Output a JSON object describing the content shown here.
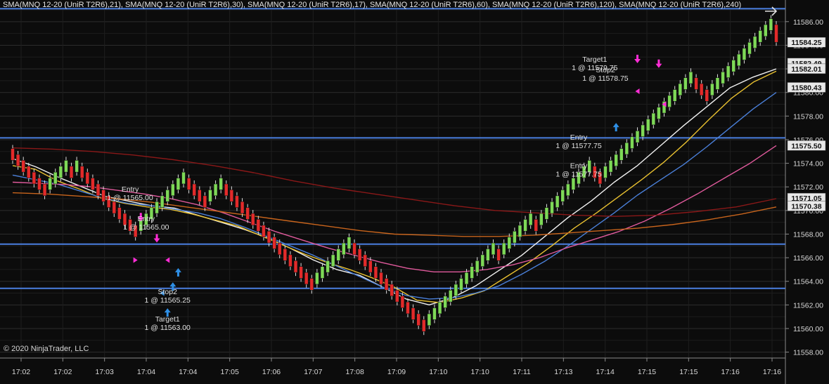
{
  "indicator_legend": "SMA(MNQ 12-20 (UniR T2R6),21), SMA(MNQ 12-20 (UniR T2R6),30), SMA(MNQ 12-20 (UniR T2R6),17), SMA(MNQ 12-20 (UniR T2R6),60), SMA(MNQ 12-20 (UniR T2R6),120), SMA(MNQ 12-20 (UniR T2R6),240)",
  "copyright": "© 2020 NinjaTrader, LLC",
  "nav_icon": "arrow-right-icon",
  "colors": {
    "background": "#0c0c0c",
    "grid": "#2a2a2a",
    "up_bar": "#7ed957",
    "down_bar": "#e32a2a",
    "horizontal_line": "#4a7fe0",
    "entry_marker": "#ff2dd6",
    "target_marker": "#2e8fe6",
    "label_box": "#e8e8e8"
  },
  "chart_data": {
    "type": "candlestick",
    "title": "",
    "xlabel": "",
    "ylabel": "",
    "ylim": [
      11557.5,
      11587.0
    ],
    "y_ticks": [
      "11586.00",
      "11584.00",
      "11582.00",
      "11580.00",
      "11578.00",
      "11576.00",
      "11574.00",
      "11572.00",
      "11570.00",
      "11568.00",
      "11566.00",
      "11564.00",
      "11562.00",
      "11560.00",
      "11558.00"
    ],
    "x_ticks": [
      "17:02",
      "17:02",
      "17:03",
      "17:04",
      "17:04",
      "17:05",
      "17:06",
      "17:07",
      "17:08",
      "17:09",
      "17:10",
      "17:10",
      "17:11",
      "17:13",
      "17:14",
      "17:15",
      "17:15",
      "17:16",
      "17:16"
    ],
    "price_labels": [
      {
        "text": "11584.25",
        "value": 11584.25
      },
      {
        "text": "11582.49",
        "value": 11582.49
      },
      {
        "text": "11582.01",
        "value": 11582.01
      },
      {
        "text": "11580.43",
        "value": 11580.43
      },
      {
        "text": "11575.50",
        "value": 11575.5
      },
      {
        "text": "11571.05",
        "value": 11571.05
      },
      {
        "text": "11570.38",
        "value": 11570.38
      }
    ],
    "horizontal_lines": [
      11576.15,
      11567.15,
      11563.4,
      11587.1
    ],
    "bars": [
      {
        "open": 11575.25,
        "close": 11574.25
      },
      {
        "open": 11574.75,
        "close": 11573.75
      },
      {
        "open": 11574.25,
        "close": 11573.25
      },
      {
        "open": 11573.75,
        "close": 11572.75
      },
      {
        "open": 11573.25,
        "close": 11572.25
      },
      {
        "open": 11572.75,
        "close": 11571.75
      },
      {
        "open": 11572.25,
        "close": 11571.25
      },
      {
        "open": 11571.75,
        "close": 11572.75
      },
      {
        "open": 11572.25,
        "close": 11573.25
      },
      {
        "open": 11572.75,
        "close": 11573.75
      },
      {
        "open": 11573.25,
        "close": 11574.25
      },
      {
        "open": 11573.75,
        "close": 11572.75
      },
      {
        "open": 11573.25,
        "close": 11574.25
      },
      {
        "open": 11573.75,
        "close": 11572.75
      },
      {
        "open": 11573.25,
        "close": 11572.25
      },
      {
        "open": 11572.75,
        "close": 11571.75
      },
      {
        "open": 11572.25,
        "close": 11571.25
      },
      {
        "open": 11571.75,
        "close": 11570.75
      },
      {
        "open": 11571.25,
        "close": 11570.25
      },
      {
        "open": 11570.75,
        "close": 11569.75
      },
      {
        "open": 11570.25,
        "close": 11569.25
      },
      {
        "open": 11569.75,
        "close": 11568.75
      },
      {
        "open": 11569.25,
        "close": 11568.25
      },
      {
        "open": 11568.75,
        "close": 11567.75
      },
      {
        "open": 11568.25,
        "close": 11569.25
      },
      {
        "open": 11568.75,
        "close": 11569.75
      },
      {
        "open": 11569.25,
        "close": 11570.25
      },
      {
        "open": 11569.75,
        "close": 11570.75
      },
      {
        "open": 11570.25,
        "close": 11571.25
      },
      {
        "open": 11570.75,
        "close": 11571.75
      },
      {
        "open": 11571.25,
        "close": 11572.25
      },
      {
        "open": 11571.75,
        "close": 11572.75
      },
      {
        "open": 11572.25,
        "close": 11573.25
      },
      {
        "open": 11572.75,
        "close": 11571.75
      },
      {
        "open": 11572.25,
        "close": 11571.25
      },
      {
        "open": 11571.75,
        "close": 11570.75
      },
      {
        "open": 11571.25,
        "close": 11570.25
      },
      {
        "open": 11570.75,
        "close": 11571.75
      },
      {
        "open": 11571.25,
        "close": 11572.25
      },
      {
        "open": 11571.75,
        "close": 11572.75
      },
      {
        "open": 11572.25,
        "close": 11571.25
      },
      {
        "open": 11571.75,
        "close": 11570.75
      },
      {
        "open": 11571.25,
        "close": 11570.25
      },
      {
        "open": 11570.75,
        "close": 11569.75
      },
      {
        "open": 11570.25,
        "close": 11569.25
      },
      {
        "open": 11569.75,
        "close": 11568.75
      },
      {
        "open": 11569.25,
        "close": 11568.25
      },
      {
        "open": 11568.75,
        "close": 11567.75
      },
      {
        "open": 11568.25,
        "close": 11567.25
      },
      {
        "open": 11567.75,
        "close": 11566.75
      },
      {
        "open": 11567.25,
        "close": 11566.25
      },
      {
        "open": 11566.75,
        "close": 11565.75
      },
      {
        "open": 11566.25,
        "close": 11565.25
      },
      {
        "open": 11565.75,
        "close": 11564.75
      },
      {
        "open": 11565.25,
        "close": 11564.25
      },
      {
        "open": 11564.75,
        "close": 11563.75
      },
      {
        "open": 11564.25,
        "close": 11563.25
      },
      {
        "open": 11563.75,
        "close": 11564.75
      },
      {
        "open": 11564.25,
        "close": 11565.25
      },
      {
        "open": 11564.75,
        "close": 11565.75
      },
      {
        "open": 11565.25,
        "close": 11566.25
      },
      {
        "open": 11565.75,
        "close": 11566.75
      },
      {
        "open": 11566.25,
        "close": 11567.25
      },
      {
        "open": 11566.75,
        "close": 11567.75
      },
      {
        "open": 11567.25,
        "close": 11566.25
      },
      {
        "open": 11566.75,
        "close": 11565.75
      },
      {
        "open": 11566.25,
        "close": 11565.25
      },
      {
        "open": 11565.75,
        "close": 11564.75
      },
      {
        "open": 11565.25,
        "close": 11564.25
      },
      {
        "open": 11564.75,
        "close": 11563.75
      },
      {
        "open": 11564.25,
        "close": 11563.25
      },
      {
        "open": 11563.75,
        "close": 11562.75
      },
      {
        "open": 11563.25,
        "close": 11562.25
      },
      {
        "open": 11562.75,
        "close": 11561.75
      },
      {
        "open": 11562.25,
        "close": 11561.25
      },
      {
        "open": 11561.75,
        "close": 11560.75
      },
      {
        "open": 11561.25,
        "close": 11560.25
      },
      {
        "open": 11560.75,
        "close": 11559.75
      },
      {
        "open": 11560.25,
        "close": 11561.25
      },
      {
        "open": 11560.75,
        "close": 11561.75
      },
      {
        "open": 11561.25,
        "close": 11562.25
      },
      {
        "open": 11561.75,
        "close": 11562.75
      },
      {
        "open": 11562.25,
        "close": 11563.25
      },
      {
        "open": 11562.75,
        "close": 11563.75
      },
      {
        "open": 11563.25,
        "close": 11564.25
      },
      {
        "open": 11563.75,
        "close": 11564.75
      },
      {
        "open": 11564.25,
        "close": 11565.25
      },
      {
        "open": 11564.75,
        "close": 11565.75
      },
      {
        "open": 11565.25,
        "close": 11566.25
      },
      {
        "open": 11565.75,
        "close": 11566.75
      },
      {
        "open": 11566.25,
        "close": 11567.25
      },
      {
        "open": 11566.75,
        "close": 11565.75
      },
      {
        "open": 11566.25,
        "close": 11567.25
      },
      {
        "open": 11566.75,
        "close": 11567.75
      },
      {
        "open": 11567.25,
        "close": 11568.25
      },
      {
        "open": 11567.75,
        "close": 11568.75
      },
      {
        "open": 11568.25,
        "close": 11569.25
      },
      {
        "open": 11568.75,
        "close": 11569.75
      },
      {
        "open": 11569.25,
        "close": 11568.25
      },
      {
        "open": 11568.75,
        "close": 11569.75
      },
      {
        "open": 11569.25,
        "close": 11570.25
      },
      {
        "open": 11569.75,
        "close": 11570.75
      },
      {
        "open": 11570.25,
        "close": 11571.25
      },
      {
        "open": 11570.75,
        "close": 11571.75
      },
      {
        "open": 11571.25,
        "close": 11572.25
      },
      {
        "open": 11571.75,
        "close": 11572.75
      },
      {
        "open": 11572.25,
        "close": 11573.25
      },
      {
        "open": 11572.75,
        "close": 11573.75
      },
      {
        "open": 11573.25,
        "close": 11574.25
      },
      {
        "open": 11573.75,
        "close": 11572.75
      },
      {
        "open": 11573.25,
        "close": 11572.25
      },
      {
        "open": 11572.75,
        "close": 11573.75
      },
      {
        "open": 11573.25,
        "close": 11574.25
      },
      {
        "open": 11573.75,
        "close": 11574.75
      },
      {
        "open": 11574.25,
        "close": 11575.25
      },
      {
        "open": 11574.75,
        "close": 11575.75
      },
      {
        "open": 11575.25,
        "close": 11576.25
      },
      {
        "open": 11575.75,
        "close": 11576.75
      },
      {
        "open": 11576.25,
        "close": 11577.25
      },
      {
        "open": 11576.75,
        "close": 11577.75
      },
      {
        "open": 11577.25,
        "close": 11578.25
      },
      {
        "open": 11577.75,
        "close": 11578.75
      },
      {
        "open": 11578.25,
        "close": 11579.25
      },
      {
        "open": 11578.75,
        "close": 11579.75
      },
      {
        "open": 11579.25,
        "close": 11580.25
      },
      {
        "open": 11579.75,
        "close": 11580.75
      },
      {
        "open": 11580.25,
        "close": 11581.25
      },
      {
        "open": 11580.75,
        "close": 11581.75
      },
      {
        "open": 11581.25,
        "close": 11580.25
      },
      {
        "open": 11580.75,
        "close": 11579.75
      },
      {
        "open": 11580.25,
        "close": 11579.25
      },
      {
        "open": 11579.75,
        "close": 11580.75
      },
      {
        "open": 11580.25,
        "close": 11581.25
      },
      {
        "open": 11580.75,
        "close": 11581.75
      },
      {
        "open": 11581.25,
        "close": 11582.25
      },
      {
        "open": 11581.75,
        "close": 11582.75
      },
      {
        "open": 11582.25,
        "close": 11583.25
      },
      {
        "open": 11582.75,
        "close": 11583.75
      },
      {
        "open": 11583.25,
        "close": 11584.25
      },
      {
        "open": 11583.75,
        "close": 11584.75
      },
      {
        "open": 11584.25,
        "close": 11585.25
      },
      {
        "open": 11584.75,
        "close": 11585.75
      },
      {
        "open": 11585.25,
        "close": 11586.25
      },
      {
        "open": 11585.75,
        "close": 11584.25
      }
    ],
    "series": [
      {
        "color": "#f2f2f2",
        "values": [
          11574.4,
          11573.7,
          11572.8,
          11572.0,
          11571.2,
          11570.8,
          11570.4,
          11570.2,
          11569.6,
          11569.0,
          11568.4,
          11567.7,
          11566.8,
          11565.8,
          11565.0,
          11564.5,
          11563.5,
          11562.5,
          11562.0,
          11562.6,
          11563.6,
          11564.9,
          11566.2,
          11567.8,
          11569.4,
          11570.8,
          11572.4,
          11573.8,
          11575.5,
          11577.2,
          11578.8,
          11580.4,
          11581.3,
          11582.0
        ]
      },
      {
        "color": "#e8c030",
        "values": [
          11573.8,
          11573.5,
          11572.5,
          11571.8,
          11571.0,
          11570.6,
          11570.3,
          11570.1,
          11569.7,
          11569.2,
          11568.7,
          11567.9,
          11567.1,
          11566.3,
          11565.6,
          11565.0,
          11564.3,
          11563.5,
          11562.4,
          11562.2,
          11562.6,
          11563.2,
          11564.4,
          11565.6,
          11567.0,
          11568.5,
          11569.8,
          11571.2,
          11572.6,
          11574.1,
          11575.8,
          11577.7,
          11579.5,
          11580.9,
          11581.8
        ]
      },
      {
        "color": "#4a7fd8",
        "values": [
          11573.0,
          11572.6,
          11572.2,
          11571.6,
          11571.0,
          11570.6,
          11570.4,
          11570.1,
          11569.8,
          11569.3,
          11568.6,
          11567.8,
          11567.0,
          11566.2,
          11565.3,
          11564.4,
          11563.5,
          11562.8,
          11562.5,
          11562.6,
          11563.0,
          11563.6,
          11564.6,
          11565.7,
          11567.0,
          11568.4,
          11569.8,
          11571.3,
          11572.6,
          11573.9,
          11575.4,
          11577.0,
          11578.6,
          11580.0
        ]
      },
      {
        "color": "#e05a9c",
        "values": [
          11572.4,
          11572.3,
          11572.2,
          11572.0,
          11571.7,
          11571.4,
          11571.0,
          11570.5,
          11569.8,
          11569.0,
          11568.2,
          11567.5,
          11566.8,
          11566.2,
          11565.6,
          11565.1,
          11564.8,
          11564.8,
          11565.0,
          11565.4,
          11566.0,
          11566.8,
          11567.5,
          11568.2,
          11569.1,
          11570.2,
          11571.4,
          11572.7,
          11574.0,
          11575.5
        ]
      },
      {
        "color": "#c8641c",
        "values": [
          11571.5,
          11571.4,
          11571.2,
          11571.0,
          11570.7,
          11570.3,
          11569.9,
          11569.5,
          11569.1,
          11568.7,
          11568.3,
          11568.0,
          11567.9,
          11567.8,
          11567.8,
          11567.9,
          11568.1,
          11568.3,
          11568.5,
          11568.8,
          11569.2,
          11569.7,
          11570.3
        ]
      },
      {
        "color": "#8a1818",
        "values": [
          11575.3,
          11575.2,
          11575.0,
          11574.7,
          11574.3,
          11573.8,
          11573.2,
          11572.5,
          11571.9,
          11571.4,
          11570.9,
          11570.4,
          11570.0,
          11569.8,
          11569.6,
          11569.5,
          11569.6,
          11569.9,
          11570.3,
          11571.0
        ]
      }
    ],
    "annotations": [
      {
        "kind": "text",
        "lines": [
          "Entry",
          "1 @ 11565.00"
        ],
        "bar": 22,
        "value": 11571.6
      },
      {
        "kind": "text",
        "lines": [
          "Entry",
          "1 @ 11565.00"
        ],
        "bar": 25,
        "value": 11569.1
      },
      {
        "kind": "text",
        "lines": [
          "Stop2",
          "1 @ 11565.25"
        ],
        "bar": 29,
        "value": 11562.9
      },
      {
        "kind": "text",
        "lines": [
          "Target1",
          "1 @ 11563.00"
        ],
        "bar": 29,
        "value": 11560.6
      },
      {
        "kind": "text",
        "lines": [
          "Entry",
          "1 @ 11577.75"
        ],
        "bar": 106,
        "value": 11576.0
      },
      {
        "kind": "text",
        "lines": [
          "Entry",
          "1 @ 11577.75"
        ],
        "bar": 106,
        "value": 11573.6
      },
      {
        "kind": "text",
        "lines": [
          "Target1",
          "1 @ 11579.75"
        ],
        "bar": 109,
        "value": 11582.6
      },
      {
        "kind": "text",
        "lines": [
          "Stop2",
          "1 @ 11578.75"
        ],
        "bar": 111,
        "value": 11581.7
      }
    ],
    "markers": [
      {
        "shape": "arrow-down",
        "color": "#ff2dd6",
        "bar": 24,
        "value": 11569.2
      },
      {
        "shape": "arrow-down",
        "color": "#ff2dd6",
        "bar": 27,
        "value": 11567.4
      },
      {
        "shape": "tri-right",
        "color": "#ff2dd6",
        "bar": 23,
        "value": 11565.8
      },
      {
        "shape": "tri-left",
        "color": "#ff2dd6",
        "bar": 29,
        "value": 11565.8
      },
      {
        "shape": "arrow-up",
        "color": "#2e8fe6",
        "bar": 29,
        "value": 11561.6
      },
      {
        "shape": "arrow-up",
        "color": "#2e8fe6",
        "bar": 30,
        "value": 11563.8
      },
      {
        "shape": "arrow-up",
        "color": "#2e8fe6",
        "bar": 31,
        "value": 11565.0
      },
      {
        "shape": "tri-left",
        "color": "#2e8fe6",
        "bar": 28,
        "value": 11563.0
      },
      {
        "shape": "arrow-up",
        "color": "#2e8fe6",
        "bar": 113,
        "value": 11577.3
      },
      {
        "shape": "arrow-down",
        "color": "#ff2dd6",
        "bar": 117,
        "value": 11582.6
      },
      {
        "shape": "arrow-down",
        "color": "#ff2dd6",
        "bar": 121,
        "value": 11582.2
      },
      {
        "shape": "tri-left",
        "color": "#ff2dd6",
        "bar": 117,
        "value": 11580.1
      },
      {
        "shape": "tri-left",
        "color": "#ff2dd6",
        "bar": 122,
        "value": 11579.0
      }
    ]
  }
}
